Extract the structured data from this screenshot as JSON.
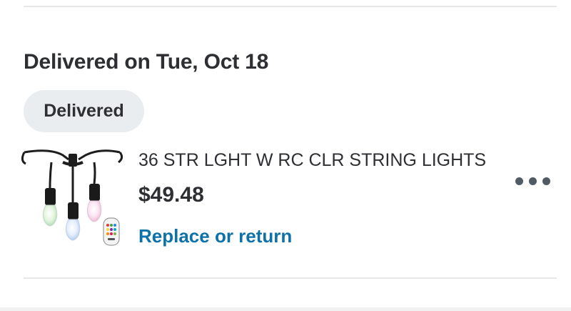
{
  "delivery": {
    "heading": "Delivered on Tue, Oct 18",
    "status_badge": "Delivered"
  },
  "item": {
    "title": "36 STR LGHT W RC CLR STRING LIGHTS",
    "price": "$49.48",
    "action_link": "Replace or return",
    "image_icon": "string-lights-product-icon",
    "more_icon": "more-options-icon"
  },
  "colors": {
    "link": "#0e72a8",
    "text": "#2e2f32",
    "badge_bg": "#e9edf0",
    "divider": "#e6e7e8"
  }
}
